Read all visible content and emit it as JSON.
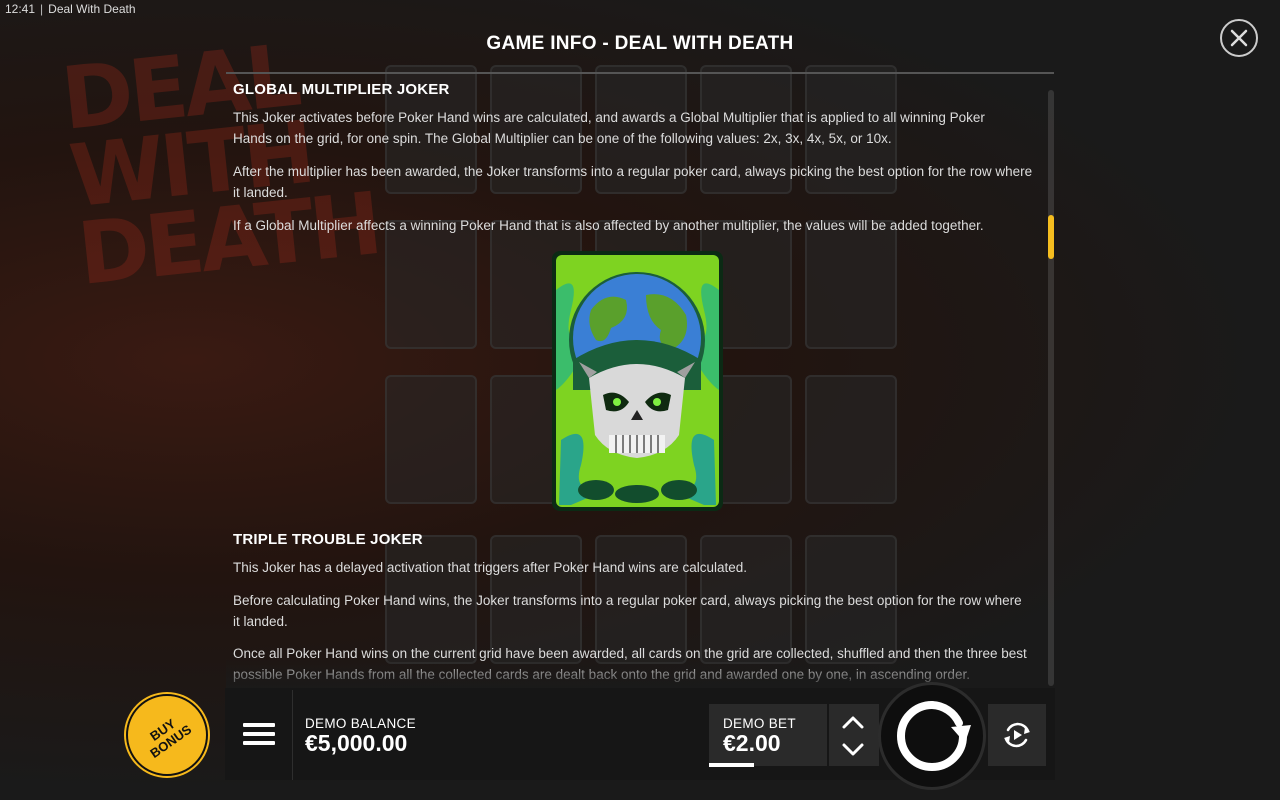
{
  "status_bar": {
    "time": "12:41",
    "window_title": "Deal With Death"
  },
  "background": {
    "logo_text": "DEAL WITH DEATH"
  },
  "dialog": {
    "title": "GAME INFO - DEAL WITH DEATH",
    "sections": {
      "global": {
        "heading": "GLOBAL MULTIPLIER JOKER",
        "p1": "This Joker activates before Poker Hand wins are calculated, and awards a Global Multiplier that is applied to all winning Poker Hands on the grid, for one spin. The Global Multiplier can be one of the following values: 2x, 3x, 4x, 5x, or 10x.",
        "p2": "After the multiplier has been awarded, the Joker transforms into a regular poker card, always picking the best option for the row where it landed.",
        "p3": "If a Global Multiplier affects a winning Poker Hand that is also affected by another multiplier, the values will be added together."
      },
      "triple": {
        "heading": "TRIPLE TROUBLE JOKER",
        "p1": "This Joker has a delayed activation that triggers after Poker Hand wins are calculated.",
        "p2": "Before calculating Poker Hand wins, the Joker transforms into a regular poker card, always picking the best option for the row where it landed.",
        "p3": "Once all Poker Hand wins on the current grid have been awarded, all cards on the grid are collected, shuffled and then the three best possible Poker Hands from all the collected cards are dealt back onto the grid and awarded one by one, in ascending order."
      }
    },
    "scroll_position": 0.22
  },
  "controls": {
    "buy_bonus_label": "BUY BONUS",
    "balance_label": "DEMO BALANCE",
    "balance_value": "€5,000.00",
    "bet_label": "DEMO BET",
    "bet_value": "€2.00"
  },
  "colors": {
    "accent": "#f6b91c",
    "background": "#1a1a1a",
    "card_green": "#7ed321"
  },
  "icons": [
    "close-icon",
    "menu-icon",
    "chevron-up-icon",
    "chevron-down-icon",
    "spin-icon",
    "autoplay-icon"
  ]
}
